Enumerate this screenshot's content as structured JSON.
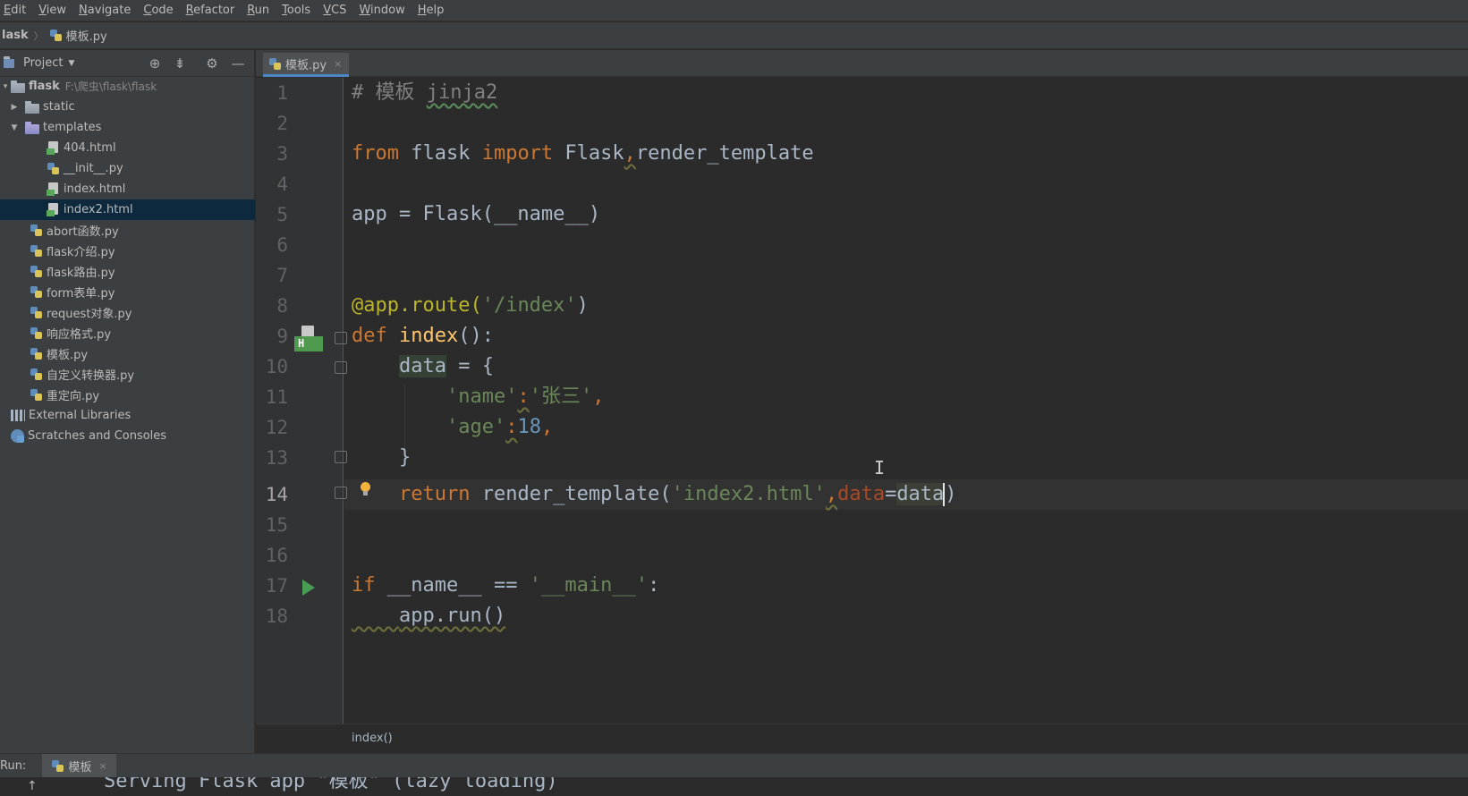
{
  "menubar": {
    "items": [
      "Edit",
      "View",
      "Navigate",
      "Code",
      "Refactor",
      "Run",
      "Tools",
      "VCS",
      "Window",
      "Help"
    ]
  },
  "navbar": {
    "root": "lask",
    "file": "模板.py"
  },
  "project": {
    "title": "Project",
    "tree": [
      {
        "label": "flask",
        "path": "F:\\爬虫\\flask\\flask"
      },
      {
        "label": "static"
      },
      {
        "label": "templates"
      },
      {
        "label": "404.html"
      },
      {
        "label": "__init__.py"
      },
      {
        "label": "index.html"
      },
      {
        "label": "index2.html"
      },
      {
        "label": "abort函数.py"
      },
      {
        "label": "flask介绍.py"
      },
      {
        "label": "flask路由.py"
      },
      {
        "label": "form表单.py"
      },
      {
        "label": "request对象.py"
      },
      {
        "label": "响应格式.py"
      },
      {
        "label": "模板.py"
      },
      {
        "label": "自定义转换器.py"
      },
      {
        "label": "重定向.py"
      },
      {
        "label": "External Libraries"
      },
      {
        "label": "Scratches and Consoles"
      }
    ]
  },
  "editor": {
    "tab": {
      "label": "模板.py"
    },
    "line_numbers": [
      "1",
      "2",
      "3",
      "4",
      "5",
      "6",
      "7",
      "8",
      "9",
      "10",
      "11",
      "12",
      "13",
      "14",
      "15",
      "16",
      "17",
      "18"
    ],
    "current_line": 14,
    "code": {
      "l1": {
        "text": "# 模板 jinja2",
        "comment": "# 模板 ",
        "word": "jinja2"
      },
      "l3": {
        "kw_from": "from",
        "mod": " flask ",
        "kw_import": "import",
        "names_a": " Flask",
        "comma": ",",
        "names_b": "render_template"
      },
      "l5": {
        "text": "app = Flask(__name__)"
      },
      "l8": {
        "deco": "@app.route(",
        "str": "'/index'",
        "close": ")"
      },
      "l9": {
        "kw": "def",
        "sp": " ",
        "fn": "index",
        "rest": "():"
      },
      "l10": {
        "indent": "    ",
        "var": "data",
        "rest": " = {"
      },
      "l11": {
        "indent": "        ",
        "key": "'name'",
        "colon": ":",
        "val": "'张三'",
        "comma": ","
      },
      "l12": {
        "indent": "        ",
        "key": "'age'",
        "colon": ":",
        "val": "18",
        "comma": ","
      },
      "l13": {
        "text": "    }"
      },
      "l14": {
        "indent": "    ",
        "kw": "return",
        "call": " render_template(",
        "str": "'index2.html'",
        "comma": ",",
        "kwarg": "data",
        "eq": "=",
        "arg": "data",
        "close": ")"
      },
      "l17": {
        "kw": "if",
        "mid": " __name__ == ",
        "str": "'__main__'",
        "colon": ":"
      },
      "l18": {
        "indent": "    ",
        "call": "app.run()"
      }
    },
    "breadcrumb": "index()"
  },
  "run": {
    "label": "Run:",
    "tab": "模板",
    "console_text": "Serving Flask app \"模板\" (lazy loading)"
  },
  "colors": {
    "background": "#2b2b2b",
    "panel": "#3c3f41",
    "keyword": "#cc7832",
    "string": "#6a8759",
    "number": "#6897bb",
    "selection": "#0d293e"
  },
  "icons": [
    "folder-icon",
    "python-file-icon",
    "html-file-icon",
    "locate-icon",
    "collapse-icon",
    "gear-icon",
    "minimize-icon",
    "template-marker-icon",
    "run-gutter-icon",
    "bulb-icon",
    "text-cursor-icon"
  ]
}
